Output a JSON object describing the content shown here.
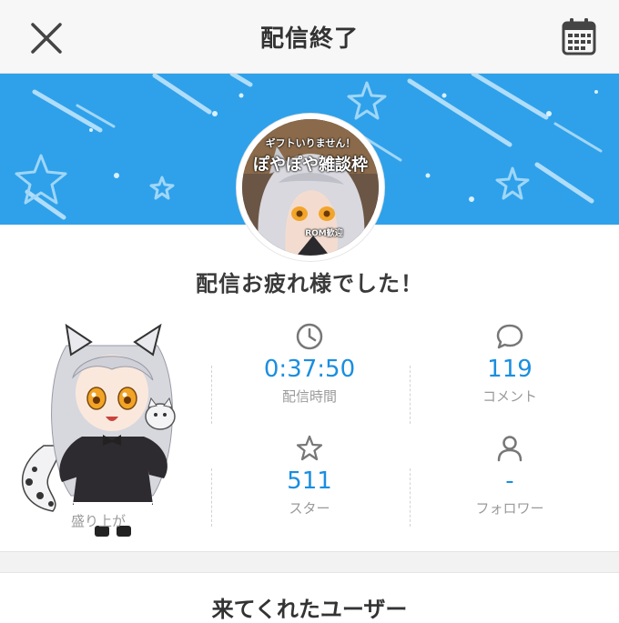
{
  "header": {
    "title": "配信終了",
    "close_icon": "close-icon",
    "calendar_icon": "calendar-icon"
  },
  "banner": {
    "color": "#2ea1ea",
    "avatar_caption_top": "ギフトいりません！",
    "avatar_caption_main": "ぽやぽや雑談枠",
    "avatar_caption_small": "ROM歓迎"
  },
  "message": "配信お疲れ様でした！",
  "character_caption": "盛り上が",
  "stats": {
    "duration": {
      "icon": "clock-icon",
      "value": "0:37:50",
      "label": "配信時間"
    },
    "comments": {
      "icon": "comment-icon",
      "value": "119",
      "label": "コメント"
    },
    "stars": {
      "icon": "star-icon",
      "value": "511",
      "label": "スター"
    },
    "followers": {
      "icon": "person-icon",
      "value": "-",
      "label": "フォロワー"
    }
  },
  "accent_color": "#1a8ee0",
  "users_section_title": "来てくれたユーザー"
}
